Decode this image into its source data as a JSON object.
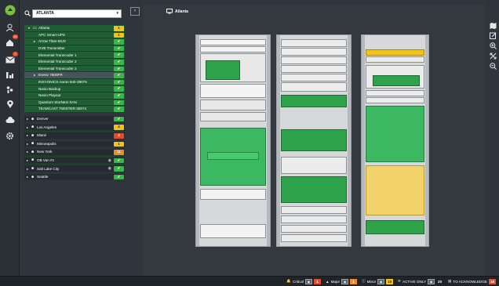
{
  "search": {
    "value": "ATLANTA"
  },
  "tree": {
    "root": {
      "label": "Atlanta",
      "badge": "1",
      "color": "#f0c419"
    },
    "children": [
      {
        "label": "APC Smart-UPS",
        "badge": "1",
        "color": "#f0c419"
      },
      {
        "label": "Arrow Titan-MUX",
        "badge": "✔",
        "color": "#3bb54a",
        "expandable": true
      },
      {
        "label": "DVB Transmitter",
        "badge": "✔",
        "color": "#3bb54a"
      },
      {
        "label": "Elemental Transcoder 1",
        "badge": "✔",
        "color": "#3bb54a"
      },
      {
        "label": "Elemental Transcoder 2",
        "badge": "✔",
        "color": "#3bb54a"
      },
      {
        "label": "Elemental Transcoder 3",
        "badge": "✔",
        "color": "#3bb54a"
      },
      {
        "label": "Evertz 7800FR",
        "badge": "✔",
        "color": "#3bb54a",
        "expandable": true,
        "selected": true
      },
      {
        "label": "INSYONICS Aaron 640-38076",
        "badge": "✔",
        "color": "#3bb54a"
      },
      {
        "label": "Nexio Backup",
        "badge": "✔",
        "color": "#3bb54a"
      },
      {
        "label": "Nexio Playout",
        "badge": "✔",
        "color": "#3bb54a"
      },
      {
        "label": "Quantum StorNext SAN",
        "badge": "✔",
        "color": "#3bb54a"
      },
      {
        "label": "TEAMCAST TWISTER-30074",
        "badge": "✔",
        "color": "#3bb54a"
      }
    ],
    "groups": [
      {
        "label": "Denver",
        "badge": "✔",
        "color": "#3bb54a",
        "icon": "building-icon"
      },
      {
        "label": "Los Angeles",
        "badge": "4",
        "color": "#f0c419",
        "icon": "monitor-icon"
      },
      {
        "label": "Miami",
        "badge": "3",
        "color": "#e24c2f",
        "icon": "antenna-icon"
      },
      {
        "label": "Minneapolis",
        "badge": "1",
        "color": "#f0c419",
        "icon": "wifi-icon"
      },
      {
        "label": "New York",
        "badge": "11",
        "color": "#f08a24",
        "icon": "camera-icon"
      },
      {
        "label": "OB Van #1",
        "badge": "✔",
        "color": "#3bb54a",
        "icon": "truck-icon",
        "eye": true
      },
      {
        "label": "Salt Lake City",
        "badge": "✔",
        "color": "#3bb54a",
        "icon": "dish-icon",
        "eye": true
      },
      {
        "label": "Seattle",
        "badge": "✔",
        "color": "#3bb54a",
        "icon": "tower-icon"
      }
    ]
  },
  "canvas": {
    "title": "Atlanta"
  },
  "rail": {
    "alarm_badge": "20",
    "mail_badge": "2"
  },
  "status": {
    "critical": {
      "label": "Critical",
      "count": "1",
      "color": "#e24c2f"
    },
    "major": {
      "label": "Major",
      "count": "1",
      "color": "#f08a24"
    },
    "minor": {
      "label": "Minor",
      "count": "10",
      "color": "#f0c419"
    },
    "active_only": {
      "label": "ACTIVE ONLY",
      "count": "20"
    },
    "ack": {
      "label": "TO ACKNOWLEDGE",
      "count": "18",
      "color": "#e24c2f"
    }
  }
}
